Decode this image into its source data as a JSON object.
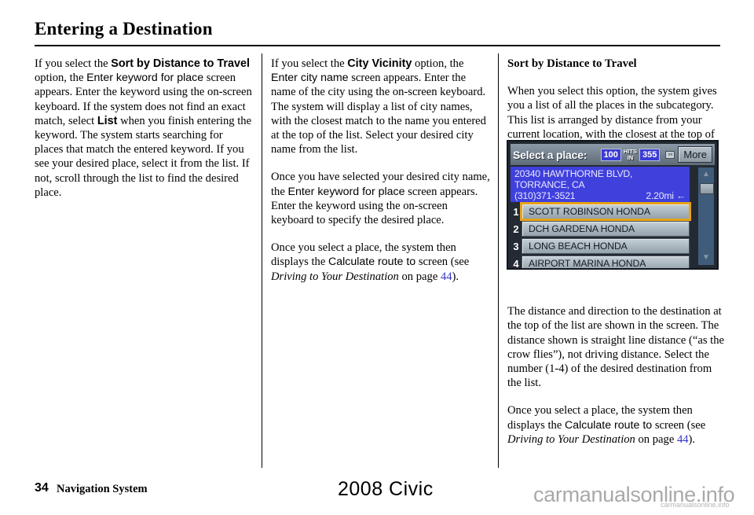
{
  "page": {
    "title": "Entering a Destination"
  },
  "columns": {
    "col1": {
      "p1": {
        "t1": "If you select the ",
        "b1": "Sort by Distance to Travel",
        "t2": " option, the ",
        "s1": "Enter keyword for place",
        "t3": " screen appears. Enter the keyword using the on-screen keyboard. If the system does not find an exact match, select ",
        "b2": "List",
        "t4": " when you finish entering the keyword. The system starts searching for places that match the entered keyword. If you see your desired place, select it from the list. If not, scroll through the list to find the desired place."
      }
    },
    "col2": {
      "p1": {
        "t1": "If you select the ",
        "b1": "City Vicinity",
        "t2": " option, the ",
        "s1": "Enter city name",
        "t3": " screen appears. Enter the name of the city using the on-screen keyboard. The system will display a list of city names, with the closest match to the name you entered at the top of the list. Select your desired city name from the list."
      },
      "p2": {
        "t1": "Once you have selected your desired city name, the ",
        "s1": "Enter keyword for place",
        "t2": " screen appears. Enter the keyword using the on-screen keyboard to specify the desired place."
      },
      "p3": {
        "t1": "Once you select a place, the system then displays the ",
        "s1": "Calculate route to",
        "t2": " screen (see ",
        "i1": "Driving to Your Destination",
        "t3": " on page ",
        "link": "44",
        "t4": ")."
      }
    },
    "col3": {
      "heading": "Sort by Distance to Travel",
      "p1": "When you select this option, the system gives you a list of all the places in the subcategory. This list is arranged by distance from your current location, with the closest at the top of the list.",
      "p2": "The distance and direction to the destination at the top of the list are shown in the screen. The distance shown is straight line distance (“as the crow flies”), not driving distance. Select the number (1-4) of the desired destination from the list.",
      "p3": {
        "t1": "Once you select a place, the system then displays the ",
        "s1": "Calculate route to",
        "t2": " screen (see ",
        "i1": "Driving to Your Destination",
        "t3": " on page ",
        "link": "44",
        "t4": ")."
      }
    }
  },
  "nav_screen": {
    "header_title": "Select a place:",
    "hits_count": "100",
    "hits_label_line1": "HITS",
    "hits_label_line2": "IN",
    "radius": "355",
    "unit_chip": "mi",
    "more_button": "More",
    "address_line1": "20340 HAWTHORNE BLVD, TORRANCE, CA",
    "phone": "(310)371-3521",
    "distance": "2.20mi",
    "direction_arrow": "←",
    "scroll_up_icon": "▲",
    "scroll_down_icon": "▼",
    "list": [
      {
        "num": "1",
        "label": "SCOTT ROBINSON HONDA",
        "selected": true
      },
      {
        "num": "2",
        "label": "DCH GARDENA HONDA",
        "selected": false
      },
      {
        "num": "3",
        "label": "LONG BEACH HONDA",
        "selected": false
      },
      {
        "num": "4",
        "label": "AIRPORT MARINA HONDA",
        "selected": false
      }
    ]
  },
  "footer": {
    "page_number": "34",
    "section": "Navigation System",
    "model": "2008  Civic",
    "watermark": "carmanualsonline.info",
    "watermark_small": "carmanualsonline.info"
  },
  "colors": {
    "link": "#3333cc",
    "nav_selected_outline": "#e8a317",
    "nav_address_bg": "#4040dd",
    "watermark": "#a9a9a9"
  }
}
